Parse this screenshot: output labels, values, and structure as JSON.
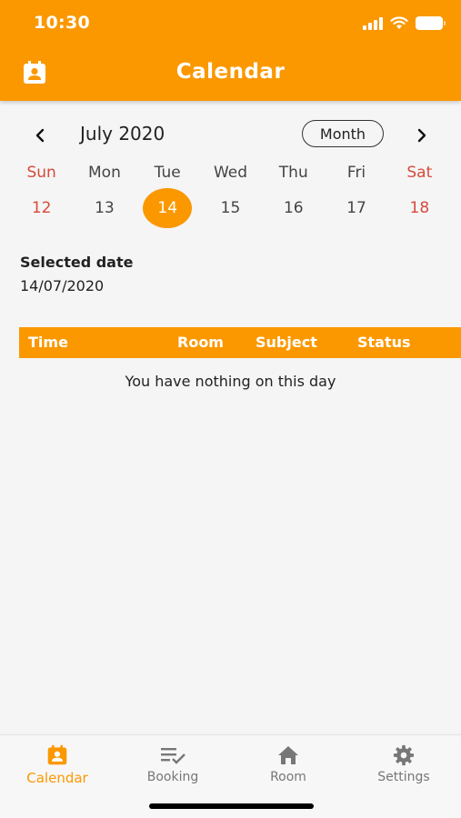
{
  "status_bar": {
    "time": "10:30"
  },
  "app_bar": {
    "title": "Calendar",
    "icon": "calendar-contact-icon"
  },
  "calendar": {
    "month_label": "July 2020",
    "view_toggle": "Month",
    "prev_icon": "chevron-left-icon",
    "next_icon": "chevron-right-icon",
    "weekdays": [
      "Sun",
      "Mon",
      "Tue",
      "Wed",
      "Thu",
      "Fri",
      "Sat"
    ],
    "days": [
      "12",
      "13",
      "14",
      "15",
      "16",
      "17",
      "18"
    ],
    "selected_day": "14",
    "accent_color": "#fb9800",
    "weekend_color": "#d64a3c"
  },
  "selected": {
    "label": "Selected date",
    "value": "14/07/2020"
  },
  "table": {
    "columns": [
      "Time",
      "Room",
      "Subject",
      "Status"
    ],
    "empty_message": "You have nothing on this day"
  },
  "bottom_nav": {
    "items": [
      {
        "label": "Calendar",
        "icon": "calendar-contact-icon",
        "active": true
      },
      {
        "label": "Booking",
        "icon": "playlist-check-icon",
        "active": false
      },
      {
        "label": "Room",
        "icon": "home-icon",
        "active": false
      },
      {
        "label": "Settings",
        "icon": "gear-icon",
        "active": false
      }
    ]
  }
}
